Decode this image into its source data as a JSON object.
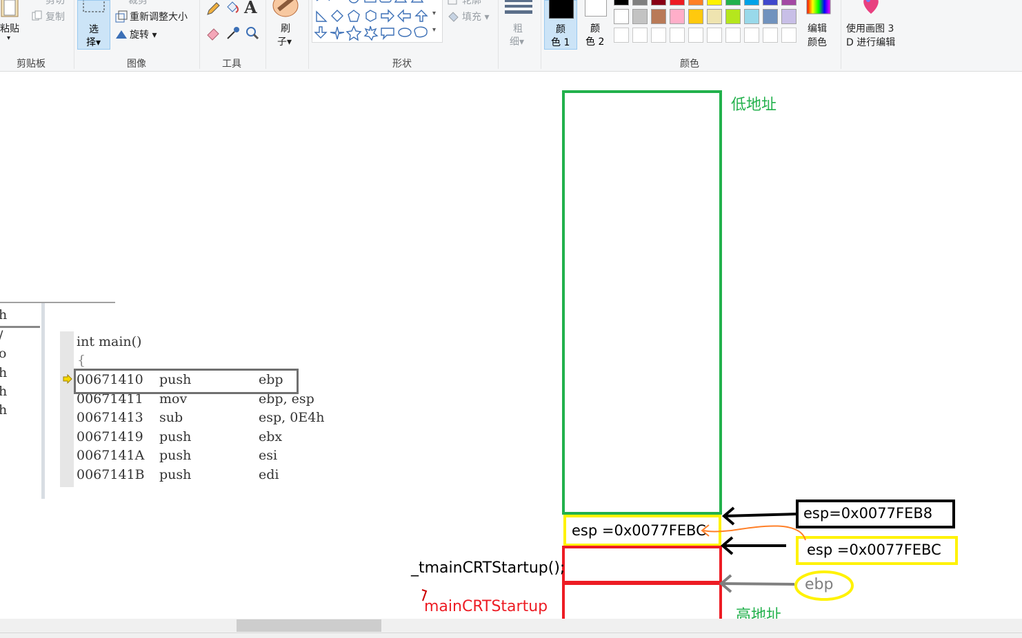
{
  "ribbon": {
    "clipboard": {
      "paste": "粘贴",
      "cut": "剪切",
      "copy": "复制",
      "group": "剪贴板"
    },
    "image": {
      "select_top": "选",
      "select_bottom": "择",
      "crop": "裁剪",
      "resize": "重新调整大小",
      "rotate": "旋转",
      "group": "图像"
    },
    "tools": {
      "group": "工具"
    },
    "brush": {
      "top": "刷",
      "bottom": "子"
    },
    "shapes": {
      "group": "形状",
      "outline": "轮廓",
      "fill": "填充"
    },
    "size": {
      "top": "粗",
      "bottom": "细"
    },
    "color1": {
      "top": "颜",
      "bottom": "色 1"
    },
    "color2": {
      "top": "颜",
      "bottom": "色 2"
    },
    "colors_group": "颜色",
    "edit_colors": {
      "top": "编辑",
      "bottom": "颜色"
    },
    "paint3d": {
      "top": "使用画图 3",
      "bottom": "D 进行编辑"
    },
    "palette_row1": [
      "#000000",
      "#7f7f7f",
      "#880015",
      "#ed1c24",
      "#ff7f27",
      "#fff200",
      "#22b14c",
      "#00a2e8",
      "#3f48cc",
      "#a349a4"
    ],
    "palette_row2": [
      "#ffffff",
      "#c3c3c3",
      "#b97a57",
      "#ffaec9",
      "#ffc90e",
      "#efe4b0",
      "#b5e61d",
      "#99d9ea",
      "#7092be",
      "#c8bfe7"
    ]
  },
  "left_panel": {
    "fragments": [
      "h",
      "/",
      "o",
      "h",
      "h",
      "h"
    ]
  },
  "disasm": {
    "header": "int main()",
    "brace": "{",
    "rows": [
      {
        "addr": "00671410",
        "op": "push",
        "args": "ebp"
      },
      {
        "addr": "00671411",
        "op": "mov",
        "args": "ebp, esp"
      },
      {
        "addr": "00671413",
        "op": "sub",
        "args": "esp, 0E4h"
      },
      {
        "addr": "00671419",
        "op": "push",
        "args": "ebx"
      },
      {
        "addr": "0067141A",
        "op": "push",
        "args": "esi"
      },
      {
        "addr": "0067141B",
        "op": "push",
        "args": "edi"
      }
    ]
  },
  "diagram": {
    "low_addr": "低地址",
    "high_addr": "高地址",
    "stack_esp": "esp =0x0077FEBC",
    "new_esp": "esp=0x0077FEB8",
    "old_esp": "esp  =0x0077FEBC",
    "ebp": "ebp",
    "frame1": "_tmainCRTStartup();",
    "frame2": "mainCRTStartup"
  },
  "colors": {
    "green": "#22b14c",
    "yellow": "#fff200",
    "red": "#ed1c24",
    "orange": "#ff7f27",
    "gray": "#7f7f7f"
  }
}
